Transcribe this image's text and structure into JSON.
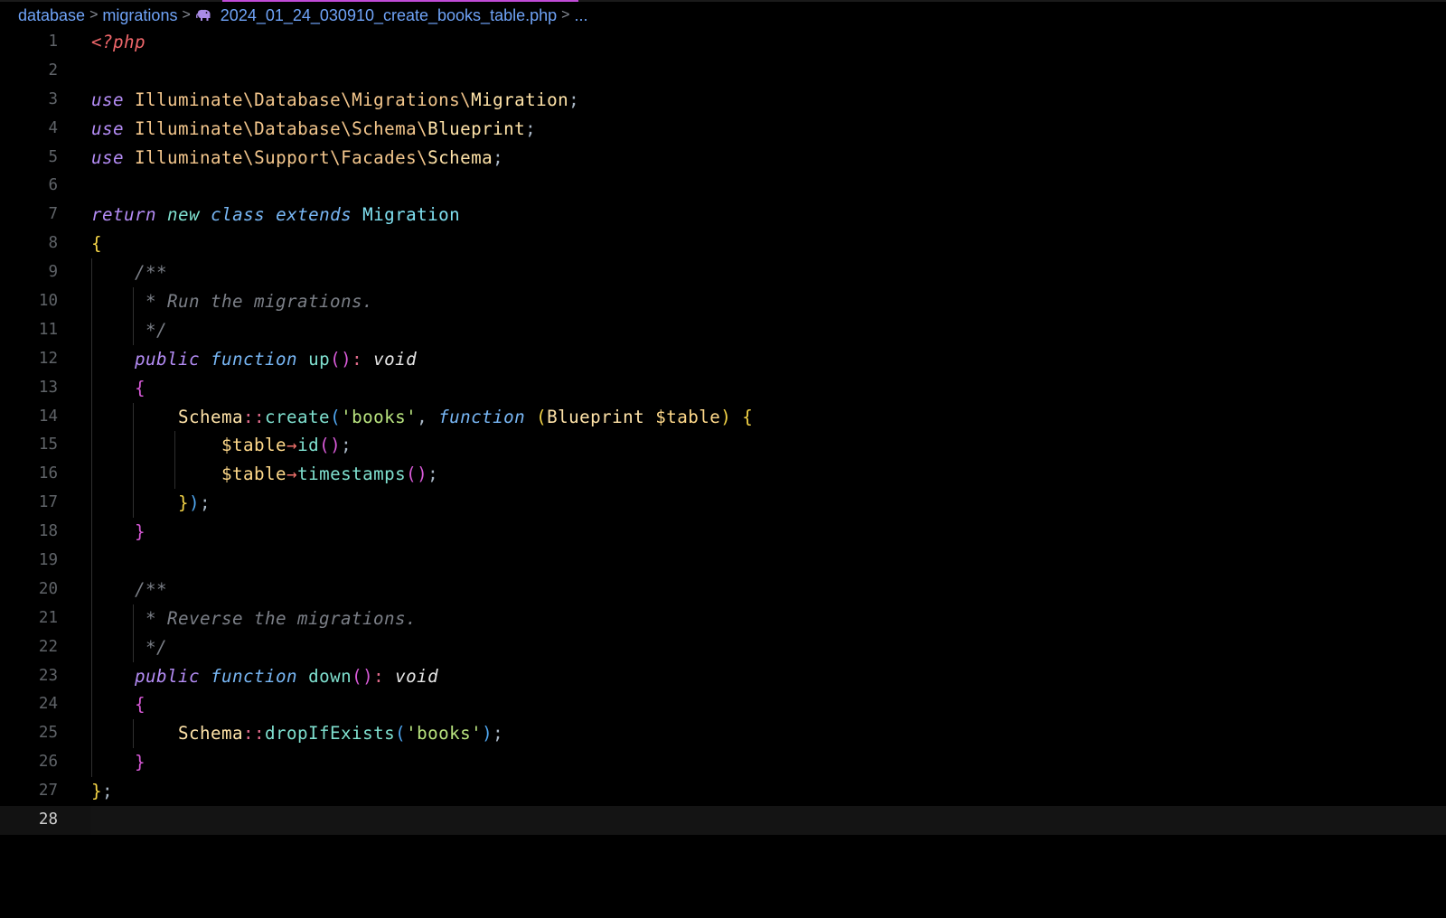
{
  "breadcrumb": {
    "items": [
      "database",
      "migrations",
      "2024_01_24_030910_create_books_table.php",
      "..."
    ],
    "separator": ">",
    "file_icon": "php-elephant-icon"
  },
  "editor": {
    "current_line": 28,
    "line_numbers": [
      "1",
      "2",
      "3",
      "4",
      "5",
      "6",
      "7",
      "8",
      "9",
      "10",
      "11",
      "12",
      "13",
      "14",
      "15",
      "16",
      "17",
      "18",
      "19",
      "20",
      "21",
      "22",
      "23",
      "24",
      "25",
      "26",
      "27",
      "28"
    ],
    "t": {
      "php_open": "<?php",
      "use": "use",
      "ns_illuminate": "Illuminate\\",
      "ns_database": "Database\\",
      "ns_migrations": "Migrations\\",
      "cls_migration": "Migration",
      "ns_schema_ns": "Schema\\",
      "cls_blueprint": "Blueprint",
      "ns_support": "Support\\",
      "ns_facades": "Facades\\",
      "cls_schema": "Schema",
      "semicolon": ";",
      "return": "return",
      "new": "new",
      "class": "class",
      "extends": "extends",
      "open_brace": "{",
      "close_brace": "}",
      "doc_open": "/**",
      "doc_run": "* Run the migrations.",
      "doc_close": "*/",
      "public": "public",
      "function": "function",
      "fn_up": "up",
      "parens": "()",
      "colon": ":",
      "void": "void",
      "double_colon": "::",
      "fn_create": "create",
      "open_paren": "(",
      "close_paren": ")",
      "str_books": "'books'",
      "comma": ",",
      "var_table": "$table",
      "arrow": "→",
      "fn_id": "id",
      "fn_timestamps": "timestamps",
      "doc_reverse": "* Reverse the migrations.",
      "fn_down": "down",
      "fn_drop": "dropIfExists",
      "space": " "
    }
  },
  "colors": {
    "background": "#000000",
    "accent_tab": "#c04bd6",
    "breadcrumb": "#6fa3f7"
  }
}
